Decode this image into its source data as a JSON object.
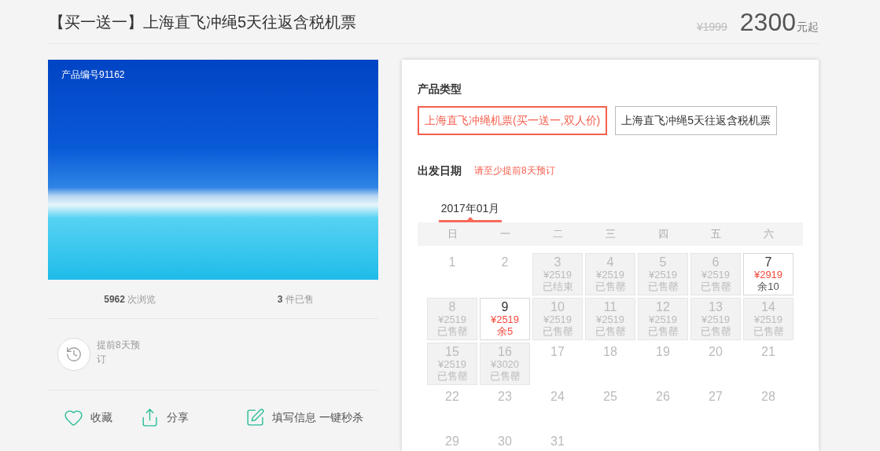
{
  "header": {
    "title": "【买一送一】上海直飞冲绳5天往返含税机票",
    "original_price": "¥1999",
    "price": "2300",
    "price_suffix": "元起"
  },
  "product_image": {
    "code_label": "产品编号91162"
  },
  "stats": [
    {
      "text": "**5962** 次浏览"
    },
    {
      "text": "**3** 件已售"
    }
  ],
  "booking_note": {
    "text": "提前8天预订"
  },
  "actions": [
    {
      "kind": "favorite",
      "label": "收藏"
    },
    {
      "kind": "share",
      "label": "分享"
    },
    {
      "kind": "fill_in",
      "label": "填写信息 一键秒杀"
    }
  ],
  "booking_panel": {
    "product_type_label": "产品类型",
    "product_types": [
      {
        "label": "上海直飞冲绳机票(买一送一,双人价)",
        "selected": true
      },
      {
        "label": "上海直飞冲绳5天往返含税机票",
        "selected": false
      }
    ],
    "departure_label": "出发日期",
    "departure_hint": "请至少提前8天预订",
    "months": [
      {
        "label": "2017年01月",
        "selected": true
      }
    ],
    "weekdays": [
      "日",
      "一",
      "二",
      "三",
      "四",
      "五",
      "六"
    ],
    "days": [
      {
        "day": "1",
        "kind": "plain"
      },
      {
        "day": "2",
        "kind": "plain"
      },
      {
        "day": "3",
        "kind": "unavailable",
        "price": "¥2519",
        "status": "已结束"
      },
      {
        "day": "4",
        "kind": "unavailable",
        "price": "¥2519",
        "status": "已售罄"
      },
      {
        "day": "5",
        "kind": "unavailable",
        "price": "¥2519",
        "status": "已售罄"
      },
      {
        "day": "6",
        "kind": "unavailable",
        "price": "¥2519",
        "status": "已售罄"
      },
      {
        "day": "7",
        "kind": "available",
        "price": "¥2919",
        "status": "余10",
        "urgent": false
      },
      {
        "day": "8",
        "kind": "unavailable",
        "price": "¥2519",
        "status": "已售罄"
      },
      {
        "day": "9",
        "kind": "available",
        "price": "¥2519",
        "status": "余5",
        "urgent": true
      },
      {
        "day": "10",
        "kind": "unavailable",
        "price": "¥2519",
        "status": "已售罄"
      },
      {
        "day": "11",
        "kind": "unavailable",
        "price": "¥2519",
        "status": "已售罄"
      },
      {
        "day": "12",
        "kind": "unavailable",
        "price": "¥2519",
        "status": "已售罄"
      },
      {
        "day": "13",
        "kind": "unavailable",
        "price": "¥2519",
        "status": "已售罄"
      },
      {
        "day": "14",
        "kind": "unavailable",
        "price": "¥2519",
        "status": "已售罄"
      },
      {
        "day": "15",
        "kind": "unavailable",
        "price": "¥2519",
        "status": "已售罄"
      },
      {
        "day": "16",
        "kind": "unavailable",
        "price": "¥3020",
        "status": "已售罄"
      },
      {
        "day": "17",
        "kind": "plain"
      },
      {
        "day": "18",
        "kind": "plain"
      },
      {
        "day": "19",
        "kind": "plain"
      },
      {
        "day": "20",
        "kind": "plain"
      },
      {
        "day": "21",
        "kind": "plain"
      },
      {
        "day": "22",
        "kind": "plain"
      },
      {
        "day": "23",
        "kind": "plain"
      },
      {
        "day": "24",
        "kind": "plain"
      },
      {
        "day": "25",
        "kind": "plain"
      },
      {
        "day": "26",
        "kind": "plain"
      },
      {
        "day": "27",
        "kind": "plain"
      },
      {
        "day": "28",
        "kind": "plain"
      },
      {
        "day": "29",
        "kind": "plain"
      },
      {
        "day": "30",
        "kind": "plain"
      },
      {
        "day": "31",
        "kind": "plain"
      }
    ]
  }
}
